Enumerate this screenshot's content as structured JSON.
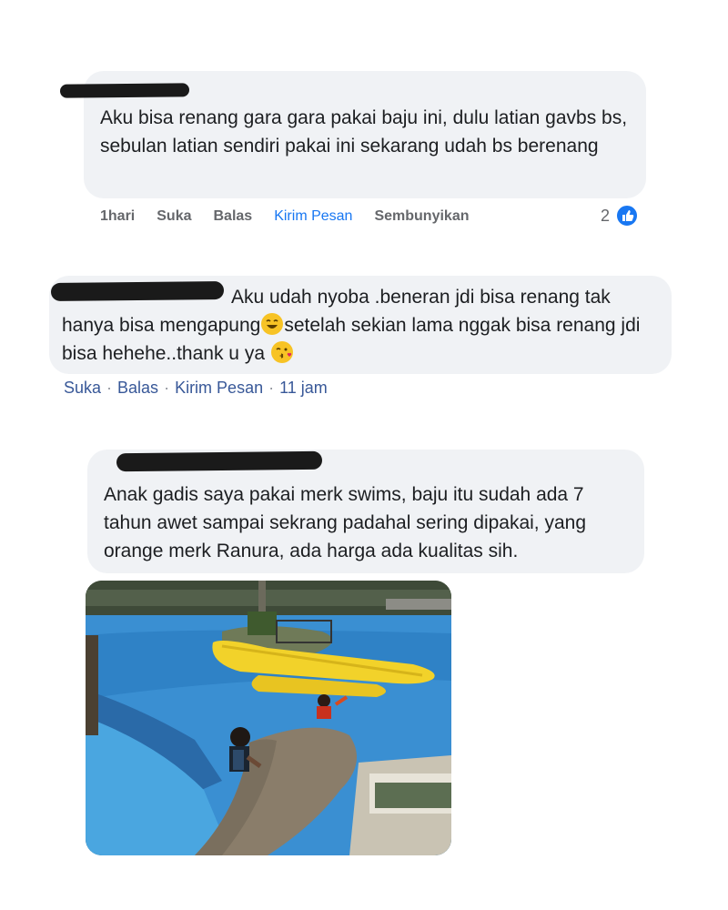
{
  "comments": [
    {
      "text": "Aku bisa renang gara gara pakai baju ini, dulu latian gavbs bs, sebulan latian sendiri pakai ini sekarang udah bs berenang",
      "actions": {
        "time": "1hari",
        "like": "Suka",
        "reply": "Balas",
        "message": "Kirim Pesan",
        "hide": "Sembunyikan"
      },
      "reaction_count": "2",
      "reaction_icon": "like-icon"
    },
    {
      "text_part1": "Aku udah nyoba .beneran jdi bisa renang tak hanya bisa mengapung",
      "emoji1": "smile-emoji-icon",
      "text_part2": "setelah sekian lama nggak bisa renang jdi bisa hehehe..thank u ya ",
      "emoji2": "kiss-emoji-icon",
      "actions": {
        "like": "Suka",
        "reply": "Balas",
        "message": "Kirim Pesan",
        "time": "11 jam",
        "separator": "·"
      }
    },
    {
      "text": "Anak gadis saya pakai merk swims, baju itu sudah ada 7 tahun awet sampai sekrang padahal sering dipakai, yang orange merk Ranura, ada harga ada kualitas sih.",
      "photo": "swimming-pool-photo"
    }
  ],
  "colors": {
    "bubble": "#f0f2f5",
    "accent_blue": "#1877f2",
    "meta_gray": "#65676b",
    "link_blue": "#385898"
  }
}
